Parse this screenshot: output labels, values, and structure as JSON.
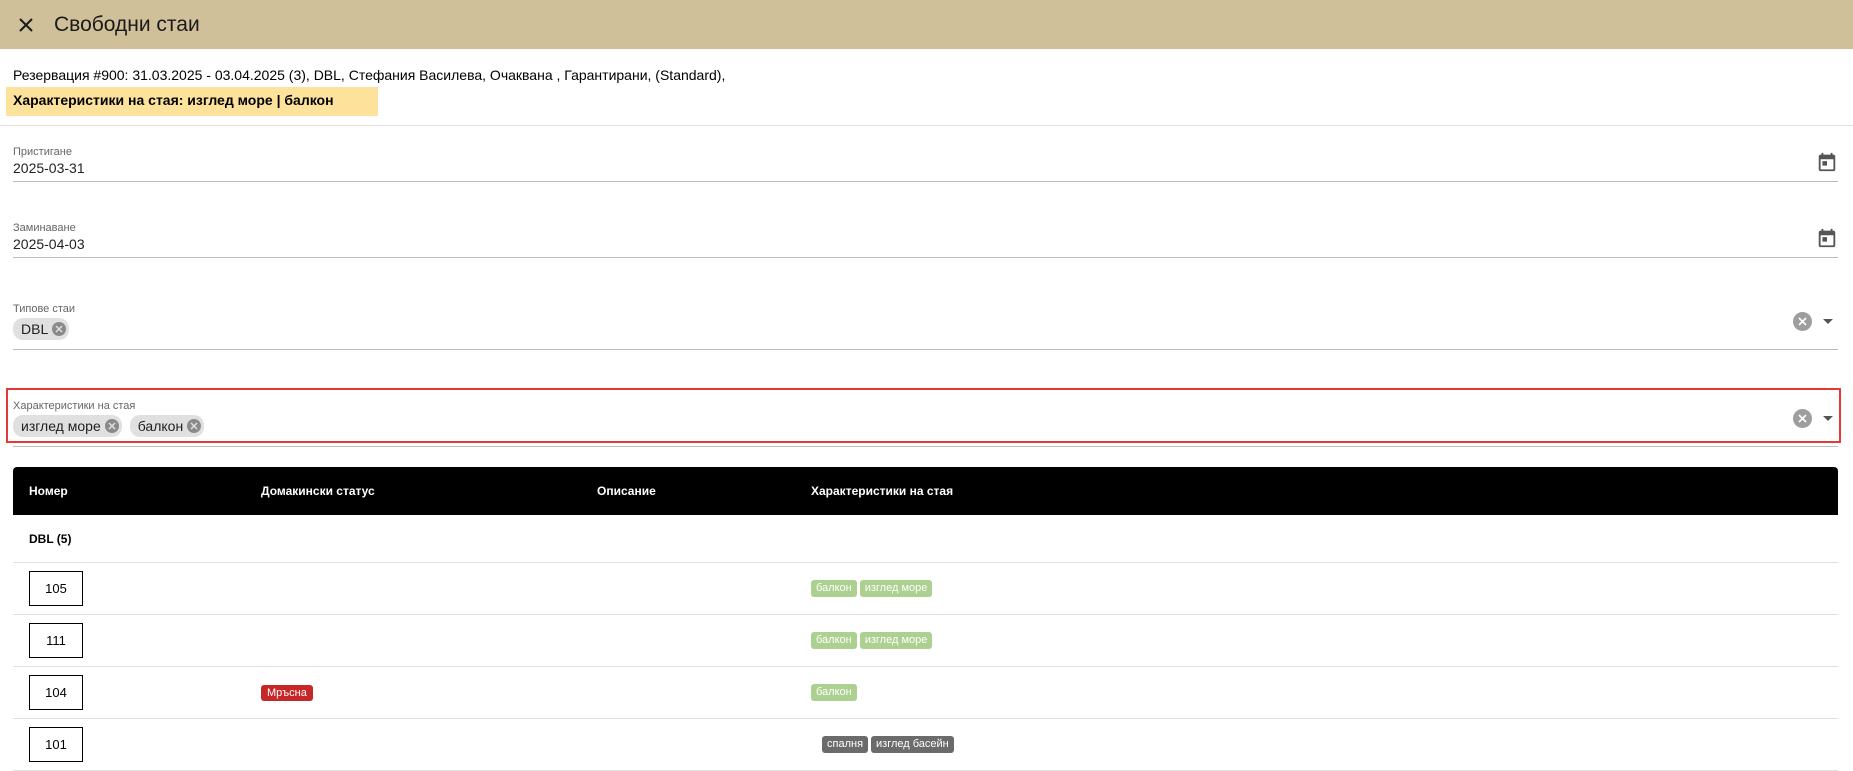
{
  "header": {
    "title": "Свободни стаи"
  },
  "reservation": {
    "summary": "Резервация #900: 31.03.2025 - 03.04.2025 (3), DBL, Стефания Василева, Очаквана , Гарантирани, (Standard),",
    "features_highlight": "Характеристики на стая: изглед море | балкон"
  },
  "form": {
    "arrival": {
      "label": "Пристигане",
      "value": "2025-03-31"
    },
    "departure": {
      "label": "Заминаване",
      "value": "2025-04-03"
    },
    "room_types": {
      "label": "Типове стаи",
      "chips": [
        "DBL"
      ]
    },
    "room_features": {
      "label": "Характеристики на стая",
      "chips": [
        "изглед море",
        "балкон"
      ]
    }
  },
  "table": {
    "columns": [
      "Номер",
      "Домакински статус",
      "Описание",
      "Характеристики на стая"
    ],
    "group": "DBL (5)",
    "rows": [
      {
        "number": "105",
        "status": "",
        "description": "",
        "features": [
          "балкон",
          "изглед море"
        ]
      },
      {
        "number": "111",
        "status": "",
        "description": "",
        "features": [
          "балкон",
          "изглед море"
        ]
      },
      {
        "number": "104",
        "status": "Мръсна",
        "description": "",
        "features": [
          "балкон"
        ]
      },
      {
        "number": "101",
        "status": "",
        "description": "",
        "features": [
          "спалня",
          "изглед басейн"
        ]
      }
    ]
  },
  "colors": {
    "header_bg": "#d0c09a",
    "highlight_bg": "#fde29c",
    "focus_border": "#e53935",
    "tag_green": "#acd08f",
    "tag_gray": "#6b6b6b",
    "status_dirty": "#c62828"
  },
  "icons": {
    "close": "close-icon",
    "calendar": "calendar-icon",
    "chip_remove": "chip-remove-icon",
    "clear_all": "clear-all-icon",
    "dropdown": "dropdown-arrow-icon"
  }
}
